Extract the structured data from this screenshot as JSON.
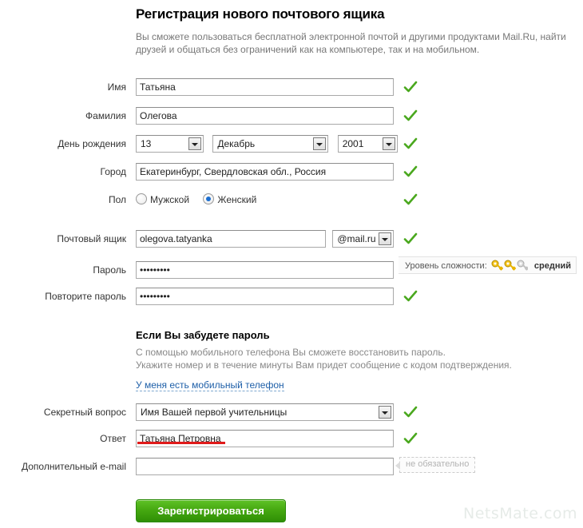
{
  "header": {
    "title": "Регистрация нового почтового ящика",
    "subtitle": "Вы сможете пользоваться бесплатной электронной почтой и другими продуктами Mail.Ru, найти друзей и общаться без ограничений как на компьютере, так и на мобильном."
  },
  "fields": {
    "first_name": {
      "label": "Имя",
      "value": "Татьяна"
    },
    "last_name": {
      "label": "Фамилия",
      "value": "Олегова"
    },
    "birthday": {
      "label": "День рождения",
      "day": "13",
      "month": "Декабрь",
      "year": "2001"
    },
    "city": {
      "label": "Город",
      "value": "Екатеринбург, Свердловская обл., Россия"
    },
    "gender": {
      "label": "Пол",
      "options": [
        "Мужской",
        "Женский"
      ],
      "selected": "Женский"
    },
    "mailbox": {
      "label": "Почтовый ящик",
      "value": "olegova.tatyanka",
      "domain": "@mail.ru"
    },
    "password": {
      "label": "Пароль",
      "value": "•••••••••"
    },
    "password_repeat": {
      "label": "Повторите пароль",
      "value": "•••••••••"
    },
    "secret_question": {
      "label": "Секретный вопрос",
      "value": "Имя Вашей первой учительницы"
    },
    "answer": {
      "label": "Ответ",
      "value": "Татьяна Петровна"
    },
    "extra_email": {
      "label": "Дополнительный e-mail",
      "value": "",
      "placeholder": ""
    }
  },
  "password_strength": {
    "label": "Уровень сложности:",
    "level": "средний",
    "keys_filled": 2,
    "keys_total": 3
  },
  "recovery": {
    "heading": "Если Вы забудете пароль",
    "line1": "С помощью мобильного телефона Вы сможете восстановить пароль.",
    "line2": "Укажите номер и в течение минуты Вам придет сообщение с кодом подтверждения.",
    "link": "У меня есть мобильный телефон"
  },
  "optional_tip": "не обязательно",
  "submit": {
    "label": "Зарегистрироваться"
  },
  "watermark": "NetsMate.com",
  "colors": {
    "check": "#4aa81e",
    "accent_green": "#46a911",
    "link": "#1e5fa8",
    "annotation_red": "#e01b1b"
  }
}
